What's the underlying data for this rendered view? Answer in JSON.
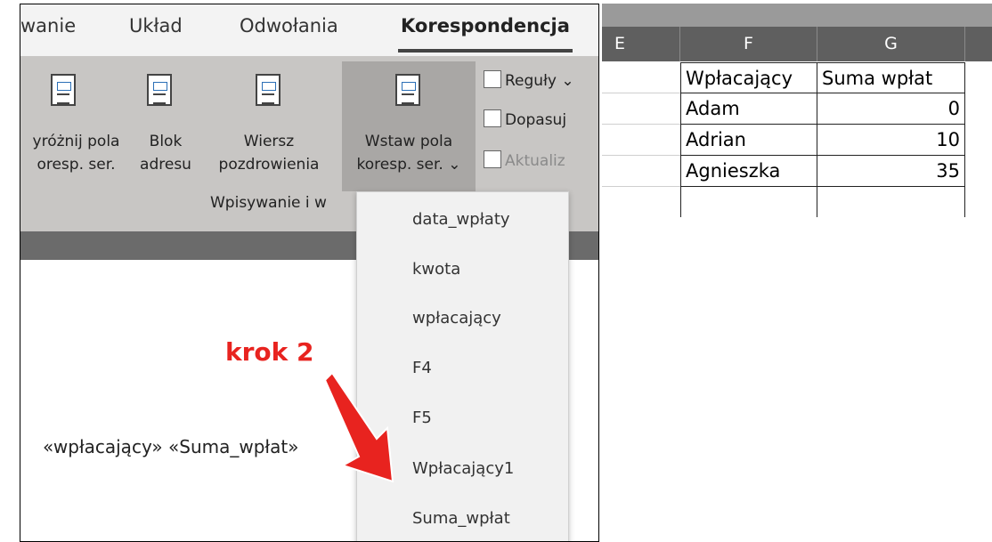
{
  "word": {
    "tabs": [
      "wanie",
      "Układ",
      "Odwołania",
      "Korespondencja"
    ],
    "ribbon": {
      "buttons": [
        {
          "line1": "yróżnij pola",
          "line2": "oresp. ser."
        },
        {
          "line1": "Blok",
          "line2": "adresu"
        },
        {
          "line1": "Wiersz",
          "line2": "pozdrowienia"
        },
        {
          "line1": "Wstaw pola",
          "line2": "koresp. ser. ⌄"
        }
      ],
      "side_items": [
        "Reguły ⌄",
        "Dopasuj",
        "Aktualiz"
      ],
      "group_label": "Wpisywanie i w"
    },
    "merge_fields_line": "«wpłacający» «Suma_wpłat»",
    "dropdown_items": [
      "data_wpłaty",
      "kwota",
      "wpłacający",
      "F4",
      "F5",
      "Wpłacający1",
      "Suma_wpłat"
    ]
  },
  "annotation": {
    "label": "krok 2",
    "color": "#e8231f"
  },
  "excel": {
    "columns": [
      "E",
      "F",
      "G"
    ],
    "table": {
      "headers": [
        "Wpłacający",
        "Suma wpłat"
      ],
      "rows": [
        [
          "Adam",
          "0"
        ],
        [
          "Adrian",
          "10"
        ],
        [
          "Agnieszka",
          "35"
        ]
      ]
    }
  }
}
